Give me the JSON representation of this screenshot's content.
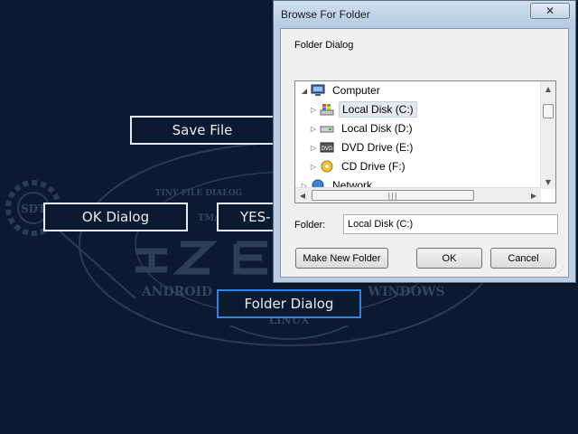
{
  "app": {
    "background_color": "#0b1a30",
    "accent_color": "#2f86e0",
    "buttons": {
      "save": "Save File",
      "ok": "OK Dialog",
      "yesno": "YES-",
      "folder": "Folder Dialog"
    },
    "logo": {
      "badge": "SDT",
      "line1": "TINY FILE DIALOG",
      "line2": "TMA",
      "line3_left": "ANDROID",
      "line3_right": "WINDOWS",
      "line4": "LINUX"
    }
  },
  "dialog": {
    "title": "Browse For Folder",
    "close_glyph": "✕",
    "description": "Folder Dialog",
    "tree": {
      "items": [
        {
          "label": "Computer",
          "icon": "computer-icon",
          "expanded": true
        },
        {
          "label": "Local Disk (C:)",
          "icon": "windows-drive-icon",
          "selected": true
        },
        {
          "label": "Local Disk (D:)",
          "icon": "drive-icon"
        },
        {
          "label": "DVD Drive (E:)",
          "icon": "dvd-icon"
        },
        {
          "label": "CD Drive (F:)",
          "icon": "cd-icon"
        },
        {
          "label": "Network",
          "icon": "network-icon"
        }
      ]
    },
    "folder_label": "Folder:",
    "folder_value": "Local Disk (C:)",
    "buttons": {
      "make_new_folder": "Make New Folder",
      "ok": "OK",
      "cancel": "Cancel"
    }
  }
}
